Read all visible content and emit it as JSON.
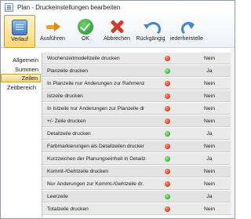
{
  "window": {
    "title": "Plan - Druckeinstellungen bearbeiten"
  },
  "toolbar": {
    "buttons": [
      {
        "label": "Verlauf",
        "icon": "history-icon",
        "pressed": true
      },
      {
        "label": "Ausführen",
        "icon": "run-icon"
      },
      {
        "label": "OK",
        "icon": "ok-icon"
      },
      {
        "label": "Abbrechen",
        "icon": "cancel-icon"
      },
      {
        "label": "Rückgängig",
        "icon": "undo-icon"
      },
      {
        "label": "iederherstelle",
        "icon": "redo-icon"
      }
    ]
  },
  "sidebar": {
    "items": [
      {
        "label": "Allgemein"
      },
      {
        "label": "Summen"
      },
      {
        "label": "Zeilen",
        "active": true
      },
      {
        "label": "Zeitbereich"
      }
    ]
  },
  "settings": {
    "rows": [
      {
        "name": "Wochenzeitmodellzeile drucken",
        "status": "red",
        "value": "Nein"
      },
      {
        "name": "Planzeile drucken",
        "status": "green",
        "value": "Ja"
      },
      {
        "name": "In Planzeile nur Änderungen zur Rahmenz",
        "status": "red",
        "value": "Nein"
      },
      {
        "name": "Istzeile drucken",
        "status": "red",
        "value": "Nein"
      },
      {
        "name": "In Istzeile nur Änderungen zur Planzeile dr",
        "status": "red",
        "value": "Nein"
      },
      {
        "name": "+/- Zeile drucken",
        "status": "red",
        "value": "Nein"
      },
      {
        "name": "Detailzeile drucken",
        "status": "green",
        "value": "Ja"
      },
      {
        "name": "Farbmarkierungen als Detailzeilen drucker",
        "status": "red",
        "value": "Nein"
      },
      {
        "name": "Kurzzeichen der Planungseinheit in Detailz",
        "status": "green",
        "value": "Ja"
      },
      {
        "name": "Kommt-/Gehtzeile drucken",
        "status": "red",
        "value": "Nein"
      },
      {
        "name": "Nur Änderungen zur Kommt-/Gehtzeile dr.",
        "status": "red",
        "value": "Nein"
      },
      {
        "name": "Leerzeile",
        "status": "green",
        "value": "Ja"
      },
      {
        "name": "Totalzeile drucken",
        "status": "red",
        "value": "Nein"
      }
    ]
  }
}
